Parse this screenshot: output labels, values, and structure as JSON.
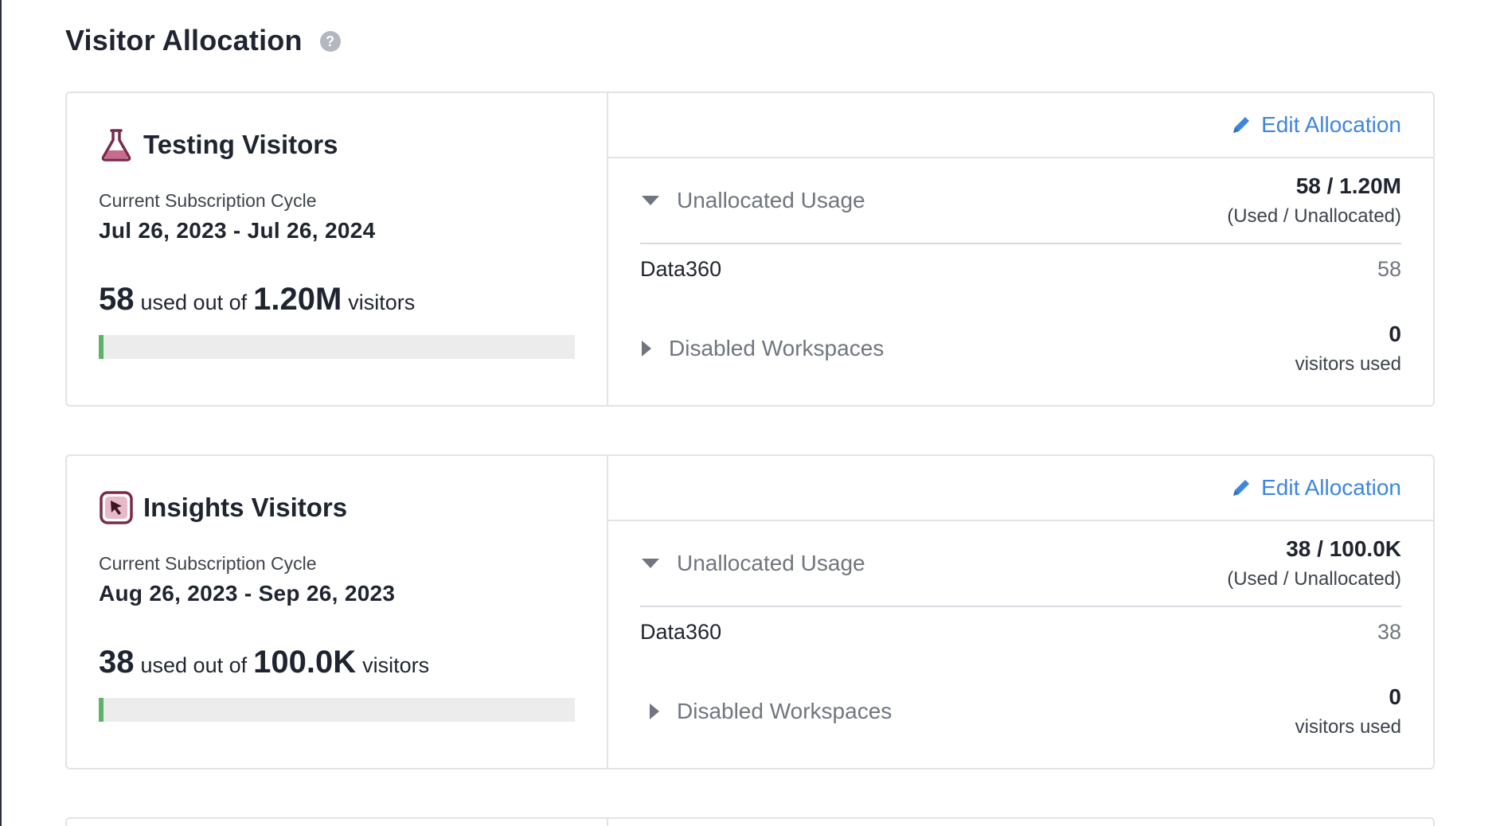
{
  "page": {
    "title": "Visitor Allocation",
    "help_glyph": "?"
  },
  "cards": [
    {
      "title": "Testing Visitors",
      "icon": "flask-icon",
      "cycle_label": "Current Subscription Cycle",
      "cycle_dates": "Jul 26, 2023 - Jul 26, 2024",
      "used": "58",
      "used_text": "used out of",
      "total": "1.20M",
      "unit_text": "visitors",
      "progress_fraction": 4.83e-05,
      "edit_label": "Edit Allocation",
      "unallocated_label": "Unallocated Usage",
      "unallocated_value": "58 / 1.20M",
      "unallocated_sub": "(Used / Unallocated)",
      "workspace_name": "Data360",
      "workspace_value": "58",
      "disabled_label": "Disabled Workspaces",
      "disabled_value": "0",
      "disabled_sub": "visitors used"
    },
    {
      "title": "Insights Visitors",
      "icon": "cursor-click-icon",
      "cycle_label": "Current Subscription Cycle",
      "cycle_dates": "Aug 26, 2023 - Sep 26, 2023",
      "used": "38",
      "used_text": "used out of",
      "total": "100.0K",
      "unit_text": "visitors",
      "progress_fraction": 0.00038,
      "edit_label": "Edit Allocation",
      "unallocated_label": "Unallocated Usage",
      "unallocated_value": "38 / 100.0K",
      "unallocated_sub": "(Used / Unallocated)",
      "workspace_name": "Data360",
      "workspace_value": "38",
      "disabled_label": "Disabled Workspaces",
      "disabled_value": "0",
      "disabled_sub": "visitors used"
    }
  ],
  "colors": {
    "accent_link": "#3d86e0",
    "progress_fill": "#5fb26a",
    "icon_brand": "#7a2a4a"
  }
}
